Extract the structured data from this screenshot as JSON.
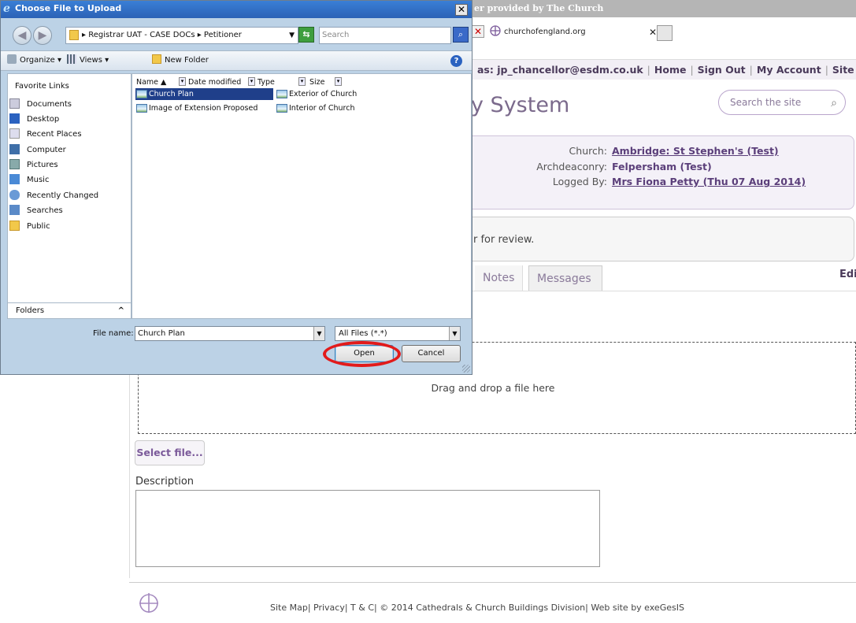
{
  "browser": {
    "title_fragment": "er provided by The Church",
    "tab_label": "churchofengland.org"
  },
  "userbar": {
    "logged_in": "as: jp_chancellor@esdm.co.uk",
    "links": [
      "Home",
      "Sign Out",
      "My Account",
      "Site Map"
    ]
  },
  "site": {
    "title_fragment": "y System",
    "search_placeholder": "Search the site"
  },
  "case_info": {
    "rows": [
      {
        "key": "Church:",
        "value": "Ambridge: St Stephen's (Test)",
        "link": true
      },
      {
        "key": "Archdeaconry:",
        "value": "Felpersham (Test)",
        "link": false
      },
      {
        "key": "Logged By:",
        "value": "Mrs Fiona Petty (Thu 07 Aug 2014)",
        "link": true
      }
    ]
  },
  "review_text": "r for review.",
  "page_tabs": [
    "Notes",
    "Messages"
  ],
  "edit_label": "Edit",
  "upload": {
    "drop_label": "Drag and drop a file here",
    "select_button": "Select file...",
    "description_label": "Description"
  },
  "footer": {
    "text": "Site Map| Privacy| T & C| © 2014 Cathedrals & Church Buildings Division| Web site by exeGesIS"
  },
  "dialog": {
    "title": "Choose File to Upload",
    "breadcrumb": "▸ Registrar UAT - CASE DOCs ▸ Petitioner",
    "search_placeholder": "Search",
    "toolbar": {
      "organize": "Organize",
      "views": "Views",
      "new_folder": "New Folder"
    },
    "favorites_heading": "Favorite Links",
    "favorites": [
      "Documents",
      "Desktop",
      "Recent Places",
      "Computer",
      "Pictures",
      "Music",
      "Recently Changed",
      "Searches",
      "Public"
    ],
    "folders_label": "Folders",
    "columns": [
      "Name",
      "Date modified",
      "Type",
      "Size"
    ],
    "files": [
      {
        "name": "Church Plan",
        "selected": true
      },
      {
        "name": "Image of Extension Proposed",
        "selected": false
      },
      {
        "name": "Exterior of Church",
        "selected": false
      },
      {
        "name": "Interior of Church",
        "selected": false
      }
    ],
    "filename_label": "File name:",
    "filename_value": "Church Plan",
    "filter_value": "All Files (*.*)",
    "open_button": "Open",
    "cancel_button": "Cancel"
  }
}
